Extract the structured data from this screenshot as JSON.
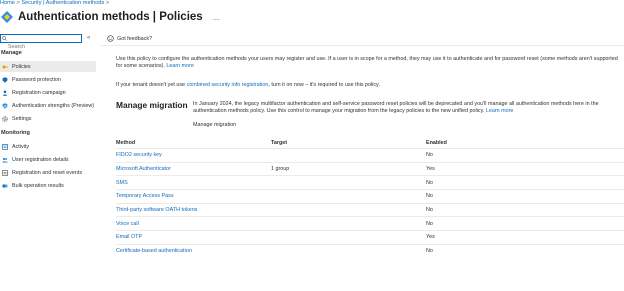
{
  "breadcrumb": {
    "home": "Home",
    "sep1": ">",
    "section": "Security | Authentication methods",
    "sep2": ">"
  },
  "header": {
    "title": "Authentication methods | Policies",
    "more": "..."
  },
  "sidebar": {
    "search_placeholder": "Search",
    "collapse": "«",
    "manage_heading": "Manage",
    "manage_items": [
      {
        "label": "Policies",
        "icon": "key-icon",
        "selected": true
      },
      {
        "label": "Password protection",
        "icon": "shield-icon"
      },
      {
        "label": "Registration campaign",
        "icon": "person-icon"
      },
      {
        "label": "Authentication strengths (Preview)",
        "icon": "shield-check-icon"
      },
      {
        "label": "Settings",
        "icon": "gear-icon"
      }
    ],
    "monitoring_heading": "Monitoring",
    "monitoring_items": [
      {
        "label": "Activity",
        "icon": "activity-icon"
      },
      {
        "label": "User registration details",
        "icon": "users-icon"
      },
      {
        "label": "Registration and reset events",
        "icon": "list-icon"
      },
      {
        "label": "Bulk operation results",
        "icon": "bulk-icon"
      }
    ]
  },
  "main": {
    "feedback": "Got feedback?",
    "intro_text": "Use this policy to configure the authentication methods your users may register and use. If a user is in scope for a method, they may use it to authenticate and for password reset (some methods aren't supported for some",
    "intro_text2": "scenarios).",
    "intro_learn_more": "Learn more",
    "combined_prefix": "If your tenant doesn't yet use",
    "combined_link": "combined security info registration",
    "combined_suffix": ", turn it on now – it's required to use this policy.",
    "migration_heading": "Manage migration",
    "migration_text": "In January 2024, the legacy multifactor authentication and self-service password reset policies will be deprecated and you'll manage all authentication methods here in the authentication",
    "migration_text2": "methods policy. Use this control to manage your migration from the legacy policies to the new unified policy.",
    "migration_learn_more": "Learn more",
    "migration_link": "Manage migration",
    "table": {
      "headers": [
        "Method",
        "Target",
        "Enabled"
      ],
      "rows": [
        {
          "method": "FIDO2 security key",
          "target": "",
          "enabled": "No"
        },
        {
          "method": "Microsoft Authenticator",
          "target": "1 group",
          "enabled": "Yes"
        },
        {
          "method": "SMS",
          "target": "",
          "enabled": "No"
        },
        {
          "method": "Temporary Access Pass",
          "target": "",
          "enabled": "No"
        },
        {
          "method": "Third-party software OATH tokens",
          "target": "",
          "enabled": "No"
        },
        {
          "method": "Voice call",
          "target": "",
          "enabled": "No"
        },
        {
          "method": "Email OTP",
          "target": "",
          "enabled": "Yes"
        },
        {
          "method": "Certificate-based authentication",
          "target": "",
          "enabled": "No"
        }
      ]
    }
  },
  "colors": {
    "accent": "#0f6cbd",
    "selected_bg": "#edebe9",
    "title_icon_blue": "#2f8ee8",
    "title_icon_yellow": "#f2c811"
  }
}
